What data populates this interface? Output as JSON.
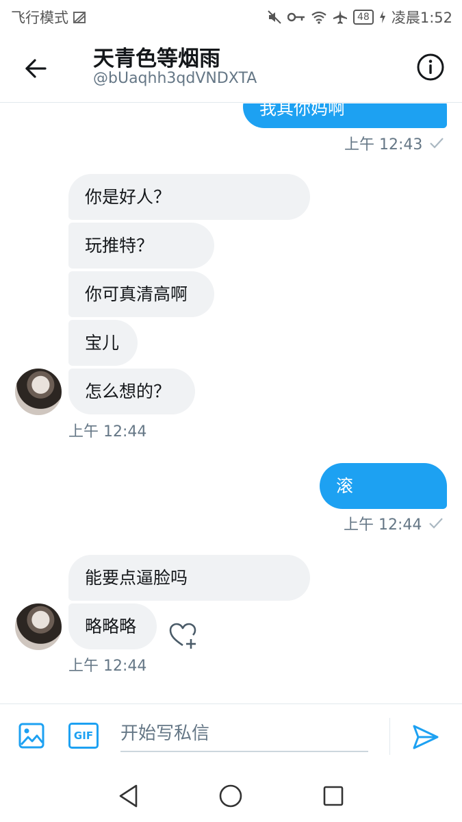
{
  "status_bar": {
    "left_label": "飞行模式",
    "battery": "48",
    "time": "凌晨1:52",
    "icons": [
      "no-sim-icon",
      "mute-icon",
      "vpn-key-icon",
      "wifi-icon",
      "airplane-icon",
      "battery-icon",
      "charging-icon"
    ]
  },
  "header": {
    "title": "天青色等烟雨",
    "handle": "@bUaqhh3qdVNDXTA",
    "back_icon": "back-arrow-icon",
    "info_icon": "info-icon"
  },
  "messages": [
    {
      "direction": "out",
      "text": "我其你妈啊",
      "timestamp": "上午 12:43",
      "read": true
    },
    {
      "direction": "in",
      "text": "你是好人？"
    },
    {
      "direction": "in",
      "text": "玩推特？"
    },
    {
      "direction": "in",
      "text": "你可真清高啊"
    },
    {
      "direction": "in",
      "text": "宝儿"
    },
    {
      "direction": "in",
      "text": "怎么想的？",
      "timestamp": "上午 12:44"
    },
    {
      "direction": "out",
      "text": "滚",
      "timestamp": "上午 12:44",
      "read": true
    },
    {
      "direction": "in",
      "text": "能要点逼脸吗"
    },
    {
      "direction": "in",
      "text": "略略略",
      "timestamp": "上午 12:44"
    }
  ],
  "composer": {
    "placeholder": "开始写私信",
    "gif_label": "GIF",
    "media_icon": "image-icon",
    "send_icon": "send-icon"
  },
  "colors": {
    "accent": "#1da1f2",
    "incoming_bubble": "#f0f2f4",
    "secondary_text": "#657786"
  }
}
